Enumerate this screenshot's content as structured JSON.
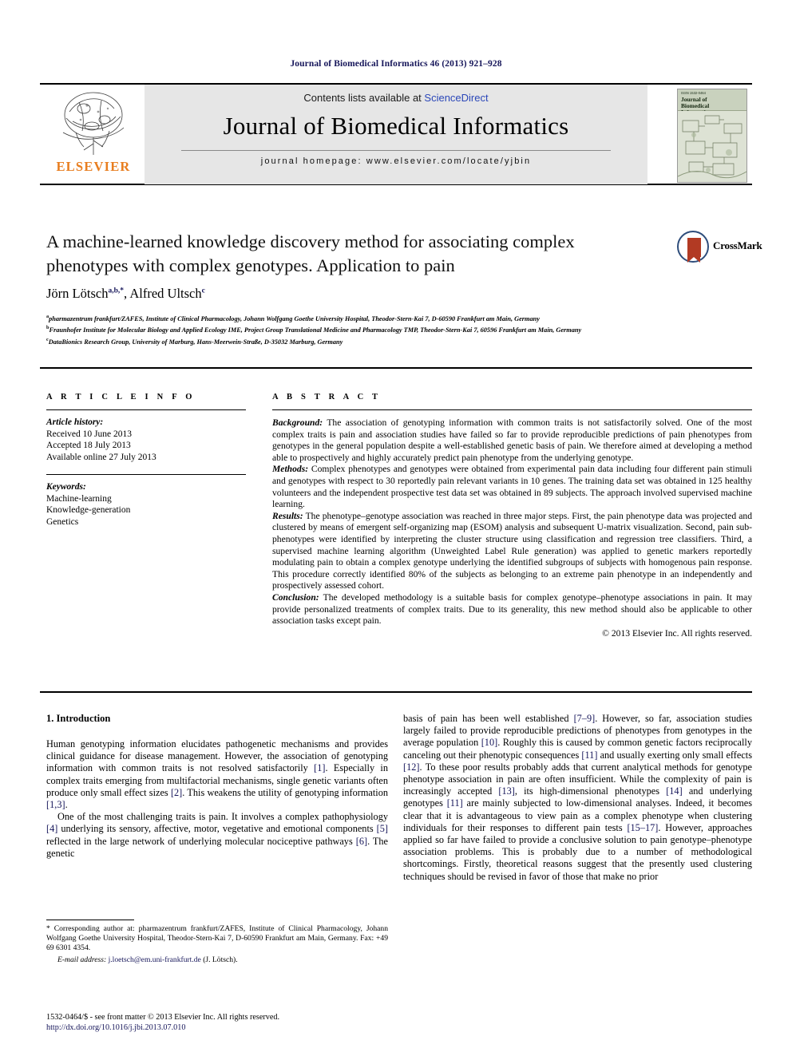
{
  "running_head": "Journal of Biomedical Informatics 46 (2013) 921–928",
  "masthead": {
    "contents_prefix": "Contents lists available at ",
    "sciencedirect": "ScienceDirect",
    "journal_title": "Journal of Biomedical Informatics",
    "homepage": "journal homepage: www.elsevier.com/locate/yjbin",
    "publisher": "ELSEVIER",
    "cover_kicker": "ISSN 1532-0464",
    "cover_title_line1": "Journal of",
    "cover_title_line2": "Biomedical",
    "cover_title_line3": "Informatics",
    "accent_color": "#2b47b8",
    "elsevier_color": "#e87d1e"
  },
  "badge": {
    "label": "CrossMark",
    "name": "crossmark-badge"
  },
  "article": {
    "title": "A machine-learned knowledge discovery method for associating complex phenotypes with complex genotypes. Application to pain",
    "authors_html": "Jörn Lötsch<sup>a,b,*</sup>, Alfred Ultsch<sup>c</sup>",
    "affiliations": [
      {
        "marker": "a",
        "text": "pharmazentrum frankfurt/ZAFES, Institute of Clinical Pharmacology, Johann Wolfgang Goethe University Hospital, Theodor-Stern-Kai 7, D-60590 Frankfurt am Main, Germany"
      },
      {
        "marker": "b",
        "text": "Fraunhofer Institute for Molecular Biology and Applied Ecology IME, Project Group Translational Medicine and Pharmacology TMP, Theodor-Stern-Kai 7, 60596 Frankfurt am Main, Germany"
      },
      {
        "marker": "c",
        "text": "DataBionics Research Group, University of Marburg, Hans-Meerwein-Straße, D-35032 Marburg, Germany"
      }
    ]
  },
  "article_info": {
    "heading": "A R T I C L E   I N F O",
    "history_label": "Article history:",
    "history": [
      "Received 10 June 2013",
      "Accepted 18 July 2013",
      "Available online 27 July 2013"
    ],
    "keywords_label": "Keywords:",
    "keywords": [
      "Machine-learning",
      "Knowledge-generation",
      "Genetics"
    ]
  },
  "abstract": {
    "heading": "A B S T R A C T",
    "sections": [
      {
        "label": "Background:",
        "text": " The association of genotyping information with common traits is not satisfactorily solved. One of the most complex traits is pain and association studies have failed so far to provide reproducible predictions of pain phenotypes from genotypes in the general population despite a well-established genetic basis of pain. We therefore aimed at developing a method able to prospectively and highly accurately predict pain phenotype from the underlying genotype."
      },
      {
        "label": "Methods:",
        "text": " Complex phenotypes and genotypes were obtained from experimental pain data including four different pain stimuli and genotypes with respect to 30 reportedly pain relevant variants in 10 genes. The training data set was obtained in 125 healthy volunteers and the independent prospective test data set was obtained in 89 subjects. The approach involved supervised machine learning."
      },
      {
        "label": "Results:",
        "text": " The phenotype–genotype association was reached in three major steps. First, the pain phenotype data was projected and clustered by means of emergent self-organizing map (ESOM) analysis and subsequent U-matrix visualization. Second, pain sub-phenotypes were identified by interpreting the cluster structure using classification and regression tree classifiers. Third, a supervised machine learning algorithm (Unweighted Label Rule generation) was applied to genetic markers reportedly modulating pain to obtain a complex genotype underlying the identified subgroups of subjects with homogenous pain response. This procedure correctly identified 80% of the subjects as belonging to an extreme pain phenotype in an independently and prospectively assessed cohort."
      },
      {
        "label": "Conclusion:",
        "text": " The developed methodology is a suitable basis for complex genotype–phenotype associations in pain. It may provide personalized treatments of complex traits. Due to its generality, this new method should also be applicable to other association tasks except pain."
      }
    ],
    "copyright": "© 2013 Elsevier Inc. All rights reserved."
  },
  "body": {
    "section_heading": "1. Introduction",
    "left_paragraphs": [
      "Human genotyping information elucidates pathogenetic mechanisms and provides clinical guidance for disease management. However, the association of genotyping information with common traits is not resolved satisfactorily [1]. Especially in complex traits emerging from multifactorial mechanisms, single genetic variants often produce only small effect sizes [2]. This weakens the utility of genotyping information [1,3].",
      "One of the most challenging traits is pain. It involves a complex pathophysiology [4] underlying its sensory, affective, motor, vegetative and emotional components [5] reflected in the large network of underlying molecular nociceptive pathways [6]. The genetic"
    ],
    "right_paragraphs": [
      "basis of pain has been well established [7–9]. However, so far, association studies largely failed to provide reproducible predictions of phenotypes from genotypes in the average population [10]. Roughly this is caused by common genetic factors reciprocally canceling out their phenotypic consequences [11] and usually exerting only small effects [12]. To these poor results probably adds that current analytical methods for genotype phenotype association in pain are often insufficient. While the complexity of pain is increasingly accepted [13], its high-dimensional phenotypes [14] and underlying genotypes [11] are mainly subjected to low-dimensional analyses. Indeed, it becomes clear that it is advantageous to view pain as a complex phenotype when clustering individuals for their responses to different pain tests [15–17]. However, approaches applied so far have failed to provide a conclusive solution to pain genotype–phenotype association problems. This is probably due to a number of methodological shortcomings. Firstly, theoretical reasons suggest that the presently used clustering techniques should be revised in favor of those that make no prior"
    ]
  },
  "footnotes": {
    "corresponding": "* Corresponding author at: pharmazentrum frankfurt/ZAFES, Institute of Clinical Pharmacology, Johann Wolfgang Goethe University Hospital, Theodor-Stern-Kai 7, D-60590 Frankfurt am Main, Germany. Fax: +49 69 6301 4354.",
    "email_label": "E-mail address:",
    "email": "j.loetsch@em.uni-frankfurt.de",
    "email_attrib": " (J. Lötsch)."
  },
  "footer": {
    "issn_line": "1532-0464/$ - see front matter © 2013 Elsevier Inc. All rights reserved.",
    "doi": "http://dx.doi.org/10.1016/j.jbi.2013.07.010"
  }
}
